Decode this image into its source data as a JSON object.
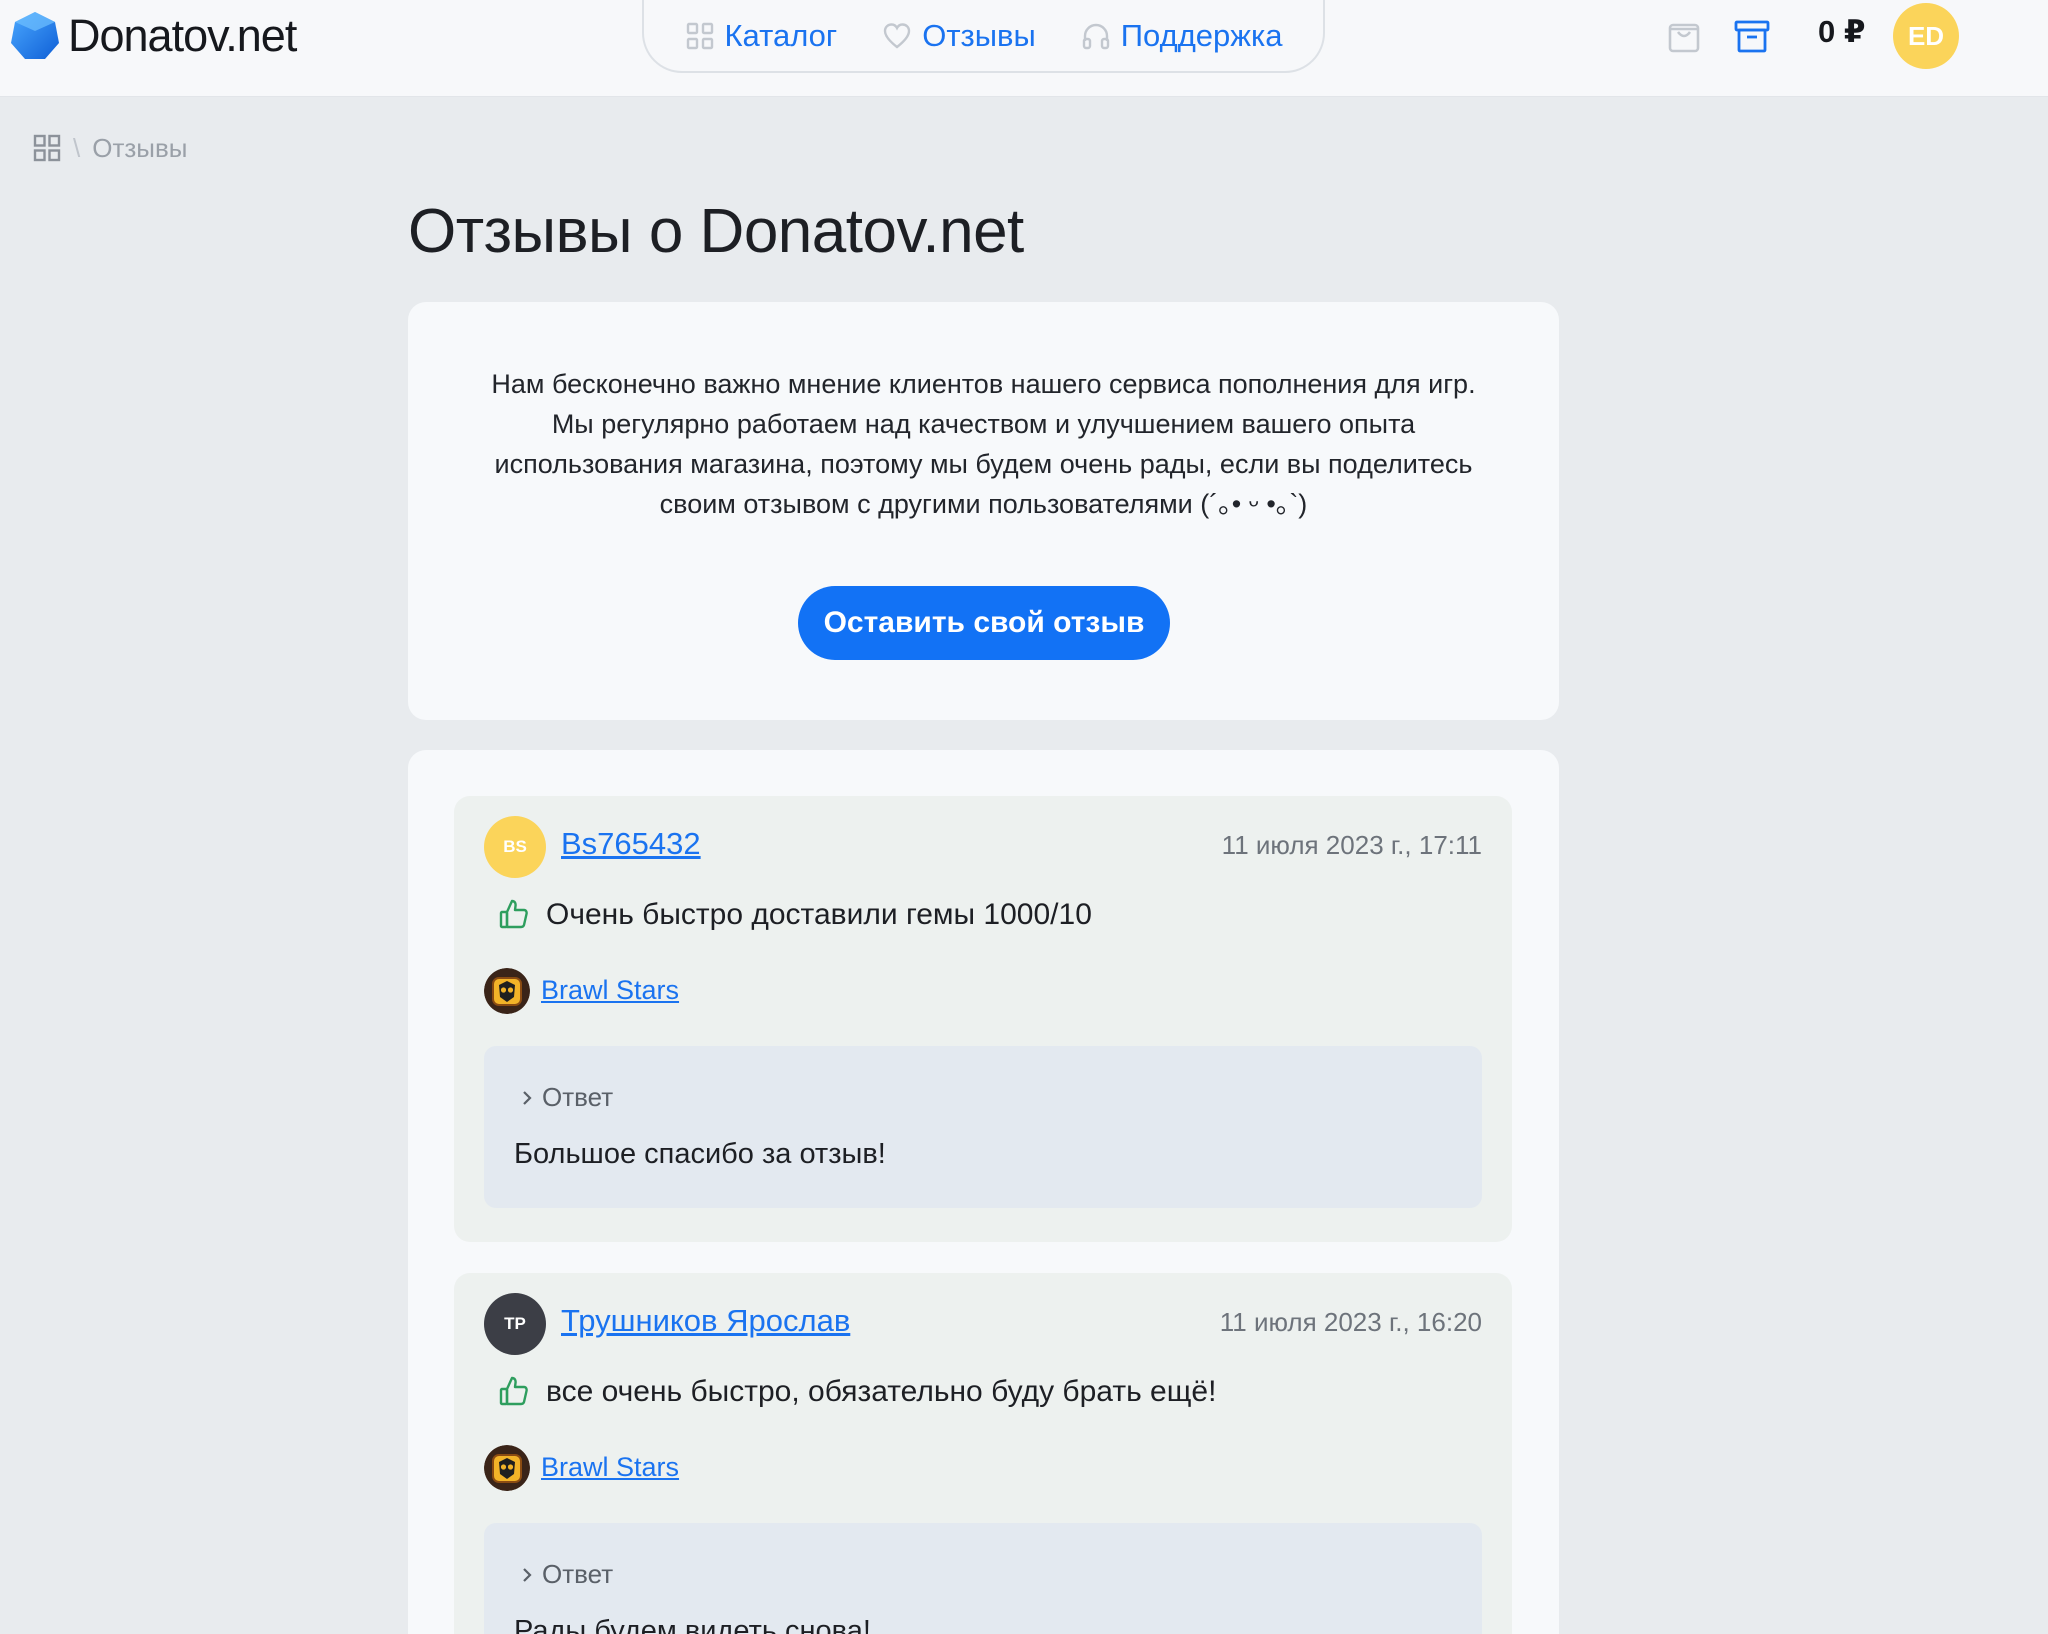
{
  "header": {
    "logo_text": "Donatov.net",
    "nav": [
      {
        "label": "Каталог",
        "icon": "grid-icon"
      },
      {
        "label": "Отзывы",
        "icon": "heart-icon"
      },
      {
        "label": "Поддержка",
        "icon": "headphones-icon"
      }
    ],
    "balance": "0 ₽",
    "user_initials": "ED"
  },
  "breadcrumb": {
    "current": "Отзывы",
    "separator": "\\"
  },
  "page_title": "Отзывы о Donatov.net",
  "intro": {
    "text": "Нам бесконечно важно мнение клиентов нашего сервиса пополнения для игр. Мы регулярно работаем над качеством и улучшением вашего опыта использования магазина, поэтому мы будем очень рады, если вы поделитесь своим отзывом с другими пользователями (´｡• ᵕ •｡`)",
    "cta_label": "Оставить свой отзыв"
  },
  "reviews": [
    {
      "initials": "BS",
      "avatar_color": "#fbd45a",
      "author": "Bs765432",
      "date": "11 июля 2023 г., 17:11",
      "text": "Очень быстро доставили гемы 1000/10",
      "game": "Brawl Stars",
      "reply_label": "Ответ",
      "reply_text": "Большое спасибо за отзыв!"
    },
    {
      "initials": "ТР",
      "avatar_color": "#3c3e46",
      "author": "Трушников Ярослав",
      "date": "11 июля 2023 г., 16:20",
      "text": "все очень быстро, обязательно буду брать ещё!",
      "game": "Brawl Stars",
      "reply_label": "Ответ",
      "reply_text": "Рады будем видеть снова!"
    }
  ],
  "colors": {
    "accent": "#1272f5",
    "link": "#1a73f0",
    "positive": "#2e9e5e",
    "avatar_user": "#fbd45a"
  }
}
